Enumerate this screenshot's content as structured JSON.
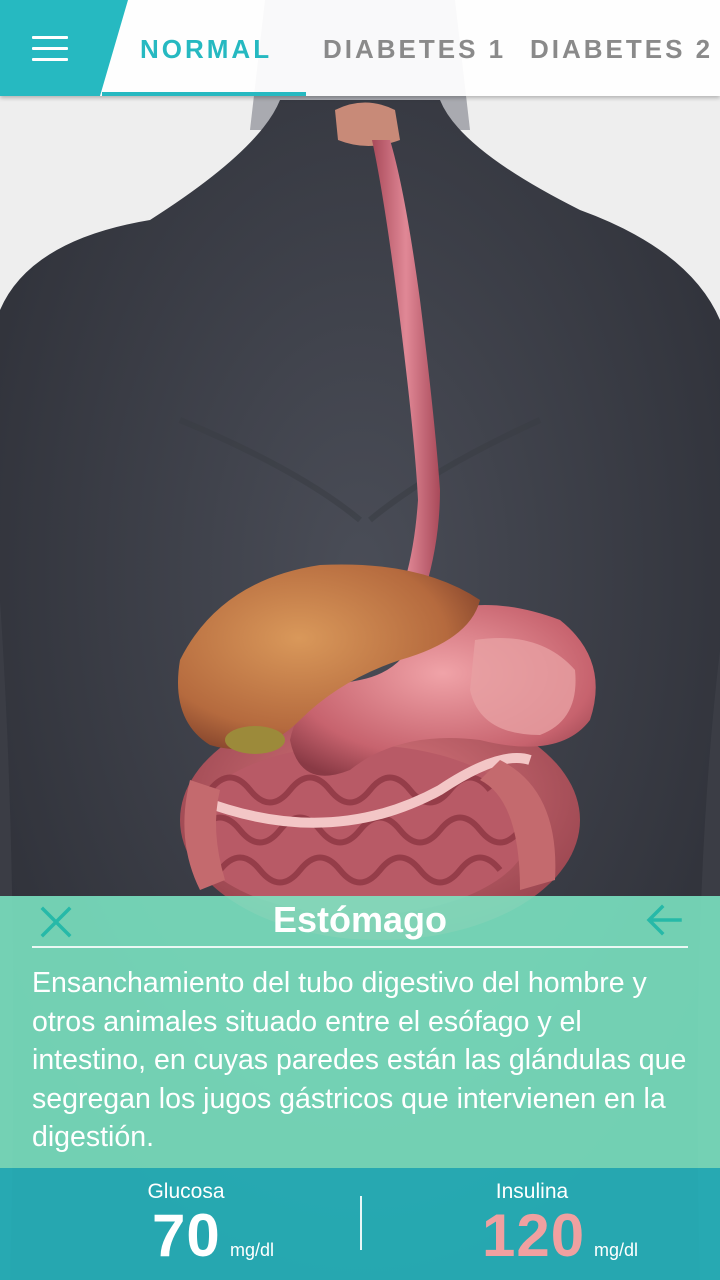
{
  "colors": {
    "accent": "#26b9c1",
    "panel": "#7ce6c4",
    "glucose_value": "#ffffff",
    "insulin_value": "#f0a0a0"
  },
  "menu": {
    "icon": "hamburger-menu-icon"
  },
  "tabs": [
    {
      "label": "NORMAL",
      "active": true
    },
    {
      "label": "DIABETES 1",
      "active": false
    },
    {
      "label": "DIABETES 2",
      "active": false
    }
  ],
  "info": {
    "title": "Estómago",
    "description": "Ensanchamiento del tubo digestivo del hombre y otros animales situado entre el esófago y el intestino, en cuyas paredes están las glándulas que segregan los jugos gástricos que intervienen en la digestión.",
    "close_icon": "close-icon",
    "back_icon": "arrow-back-icon"
  },
  "stats": {
    "glucose": {
      "label": "Glucosa",
      "value": "70",
      "unit": "mg/dl"
    },
    "insulin": {
      "label": "Insulina",
      "value": "120",
      "unit": "mg/dl"
    }
  }
}
